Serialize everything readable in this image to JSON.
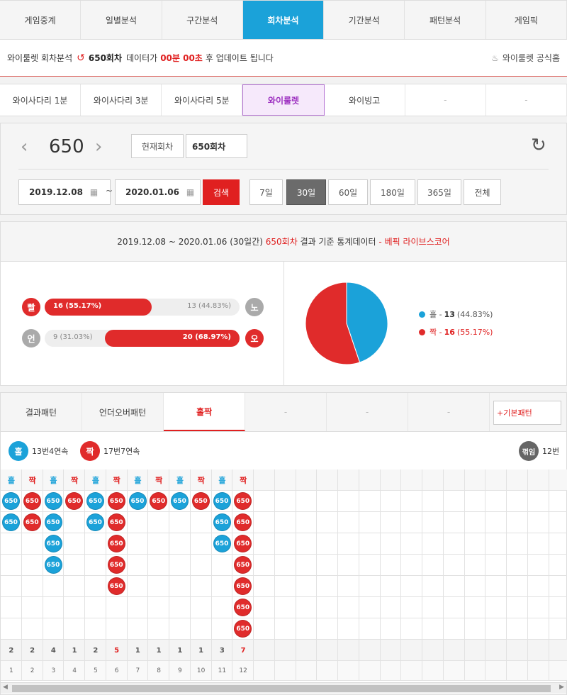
{
  "topnav": {
    "tabs": [
      "게임중계",
      "일별분석",
      "구간분석",
      "회차분석",
      "기간분석",
      "패턴분석",
      "게임픽"
    ],
    "active": 3
  },
  "notice": {
    "prefix": "와이룰렛 회차분석",
    "round": "650회차",
    "middle": "데이터가",
    "time": "00분 00초",
    "suffix": "후 업데이트 됩니다",
    "home_link": "와이룰렛 공식홈"
  },
  "subnav": {
    "tabs": [
      "와이사다리 1분",
      "와이사다리 3분",
      "와이사다리 5분",
      "와이룰렛",
      "와이빙고",
      "-",
      "-"
    ],
    "active": 3
  },
  "roundnav": {
    "current_round": "650",
    "current_button": "현재회차",
    "round_input": "650회차",
    "start_date": "2019.12.08",
    "tilde": "~",
    "end_date": "2020.01.06",
    "search": "검색",
    "periods": [
      "7일",
      "30일",
      "60일",
      "180일",
      "365일",
      "전체"
    ],
    "active_period": 1
  },
  "stats": {
    "header_text": "2019.12.08 ~ 2020.01.06 (30일간)",
    "header_round": "650회차",
    "header_mid": "결과 기준 통계데이터",
    "header_brand": "- 베픽 라이브스코어",
    "rows": [
      {
        "left_badge": "빨",
        "left_label": "16 (55.17%)",
        "right_label": "13 (44.83%)",
        "right_badge": "노",
        "fill_fraction": 0.55
      },
      {
        "left_badge": "언",
        "left_label": "9 (31.03%)",
        "right_label": "20 (68.97%)",
        "right_badge": "오",
        "fill_fraction": 0.69
      }
    ],
    "legend": [
      {
        "name": "홀",
        "value": "13",
        "pct": "(44.83%)",
        "color": "#1ba2d9"
      },
      {
        "name": "짝",
        "value": "16",
        "pct": "(55.17%)",
        "color": "#e02b2b"
      }
    ]
  },
  "pattern": {
    "tabs": [
      "결과패턴",
      "언더오버패턴",
      "홀짝",
      "-",
      "-",
      "-"
    ],
    "active": 2,
    "basic_button": "+기본패턴",
    "summary_odd_badge": "홀",
    "summary_odd": "13번4연속",
    "summary_even_badge": "짝",
    "summary_even": "17번7연속",
    "summary_turn_badge": "꺾임",
    "summary_turn": "12번",
    "ball_label": "650",
    "columns": [
      {
        "head": "홀",
        "kind": "odd",
        "count": 2,
        "index": "1"
      },
      {
        "head": "짝",
        "kind": "even",
        "count": 2,
        "index": "2"
      },
      {
        "head": "홀",
        "kind": "odd",
        "count": 4,
        "index": "3"
      },
      {
        "head": "짝",
        "kind": "even",
        "count": 1,
        "index": "4"
      },
      {
        "head": "홀",
        "kind": "odd",
        "count": 2,
        "index": "5"
      },
      {
        "head": "짝",
        "kind": "even",
        "count": 5,
        "index": "6",
        "highlight": true
      },
      {
        "head": "홀",
        "kind": "odd",
        "count": 1,
        "index": "7"
      },
      {
        "head": "짝",
        "kind": "even",
        "count": 1,
        "index": "8"
      },
      {
        "head": "홀",
        "kind": "odd",
        "count": 1,
        "index": "9"
      },
      {
        "head": "짝",
        "kind": "even",
        "count": 1,
        "index": "10"
      },
      {
        "head": "홀",
        "kind": "odd",
        "count": 3,
        "index": "11"
      },
      {
        "head": "짝",
        "kind": "even",
        "count": 7,
        "index": "12",
        "highlight": true
      }
    ]
  },
  "colors": {
    "blue": "#1ba2d9",
    "red": "#e02b2b",
    "purple": "#9c2fc0"
  }
}
